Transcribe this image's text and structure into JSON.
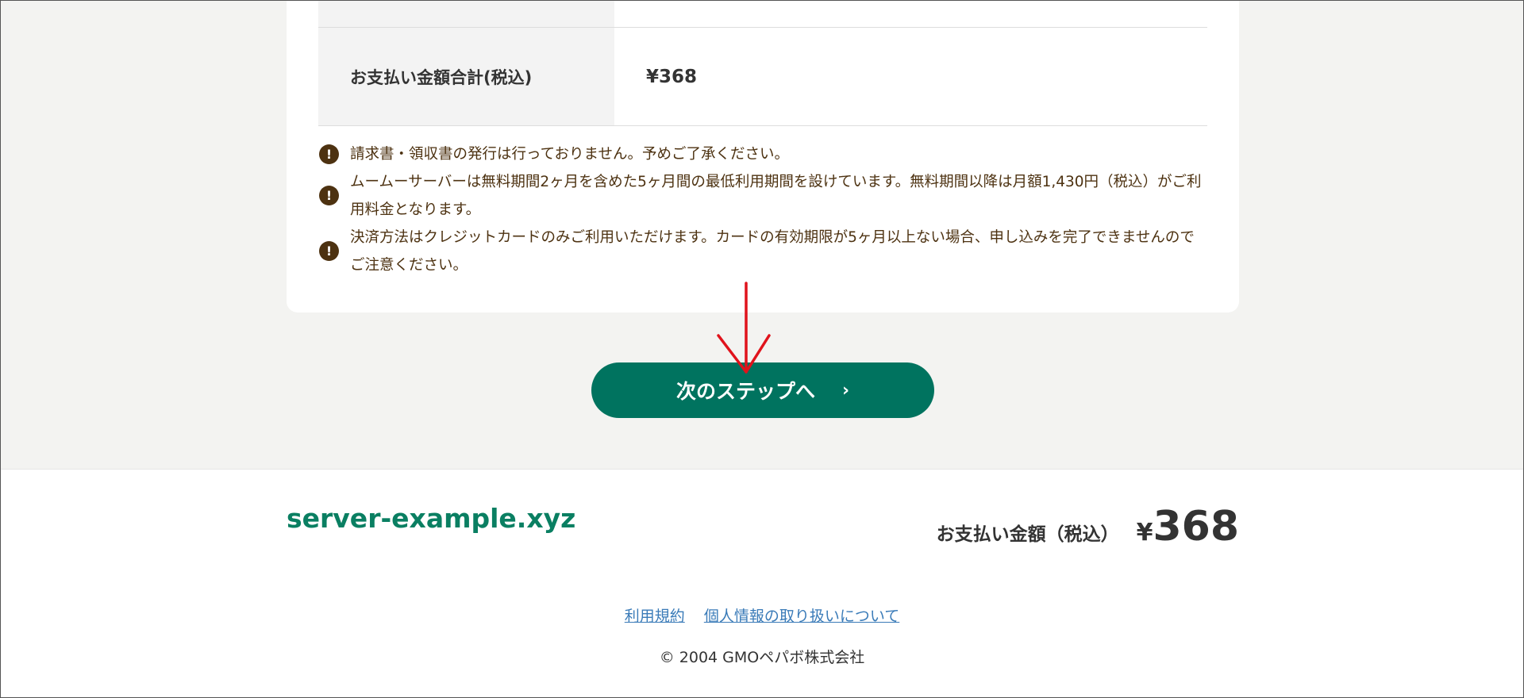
{
  "summary": {
    "total_label": "お支払い金額合計(税込)",
    "total_value": "¥368"
  },
  "notes": [
    {
      "icon": "exclamation-icon",
      "text": "請求書・領収書の発行は行っておりません。予めご了承ください。"
    },
    {
      "icon": "exclamation-icon",
      "text": "ムームーサーバーは無料期間2ヶ月を含めた5ヶ月間の最低利用期間を設けています。無料期間以降は月額1,430円（税込）がご利用料金となります。"
    },
    {
      "icon": "exclamation-icon",
      "text": "決済方法はクレジットカードのみご利用いただけます。カードの有効期限が5ヶ月以上ない場合、申し込みを完了できませんのでご注意ください。"
    }
  ],
  "next_button": {
    "label": "次のステップへ",
    "chevron": "›"
  },
  "annotation": {
    "arrow_color": "#e0131c"
  },
  "footer_bar": {
    "domain": "server-example.xyz",
    "total_label": "お支払い金額（税込）",
    "yen": "¥",
    "amount": "368"
  },
  "footer_links": {
    "terms": "利用規約",
    "privacy": "個人情報の取り扱いについて"
  },
  "copyright": "© 2004 GMOペパボ株式会社",
  "colors": {
    "brand_green": "#00735f",
    "domain_green": "#0a7f62",
    "note_brown": "#4d3211",
    "link_blue": "#3a7bb8"
  }
}
